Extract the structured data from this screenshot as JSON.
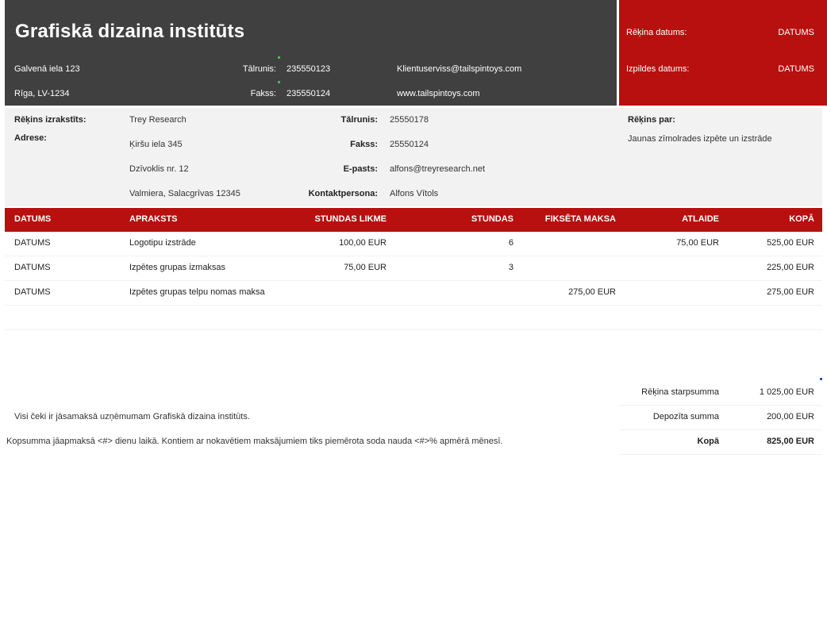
{
  "header": {
    "company": "Grafiskā dizaina institūts",
    "address_line1": "Galvenā iela 123",
    "address_line2": "Rīga, LV-1234",
    "phone_label": "Tālrunis:",
    "phone": "235550123",
    "fax_label": "Fakss:",
    "fax": "235550124",
    "email": "Klientuserviss@tailspintoys.com",
    "web": "www.tailspintoys.com",
    "invoice_date_label": "Rēķina datums:",
    "invoice_date": "DATUMS",
    "due_date_label": "Izpildes datums:",
    "due_date": "DATUMS"
  },
  "billing": {
    "issued_to_label": "Rēķins izrakstīts:",
    "issued_to": "Trey Research",
    "address_label": "Adrese:",
    "address_lines": [
      "Ķiršu iela 345",
      "Dzīvoklis nr. 12",
      "Valmiera, Salacgrīvas 12345"
    ],
    "phone_label": "Tālrunis:",
    "phone": "25550178",
    "fax_label": "Fakss:",
    "fax": "25550124",
    "email_label": "E-pasts:",
    "email": "alfons@treyresearch.net",
    "contact_label": "Kontaktpersona:",
    "contact": "Alfons Vītols",
    "for_label": "Rēķins par:",
    "for": "Jaunas zīmolrades izpēte un izstrāde"
  },
  "table": {
    "columns": [
      "DATUMS",
      "APRAKSTS",
      "STUNDAS LIKME",
      "STUNDAS",
      "FIKSĒTA MAKSA",
      "ATLAIDE",
      "KOPĀ"
    ],
    "rows": [
      [
        "DATUMS",
        "Logotipu izstrāde",
        "100,00 EUR",
        "6",
        "",
        "75,00 EUR",
        "525,00 EUR"
      ],
      [
        "DATUMS",
        "Izpētes grupas izmaksas",
        "75,00 EUR",
        "3",
        "",
        "",
        "225,00 EUR"
      ],
      [
        "DATUMS",
        "Izpētes grupas telpu nomas maksa",
        "",
        "",
        "275,00 EUR",
        "",
        "275,00 EUR"
      ]
    ]
  },
  "summary": {
    "subtotal_label": "Rēķina starpsumma",
    "subtotal": "1 025,00 EUR",
    "deposit_label": "Depozīta summa",
    "deposit": "200,00 EUR",
    "total_label": "Kopā",
    "total": "825,00 EUR"
  },
  "notes": {
    "line1": "Visi čeki ir jāsamaksā uzņēmumam Grafiskā dizaina institūts.",
    "line2": "Kopsumma jāapmaksā <#> dienu laikā. Kontiem ar nokavētiem maksājumiem tiks piemērota soda nauda <#>% apmērā mēnesī."
  },
  "colors": {
    "header_dark": "#404040",
    "accent_red": "#b80f0f",
    "band_gray": "#f2f2f2"
  }
}
